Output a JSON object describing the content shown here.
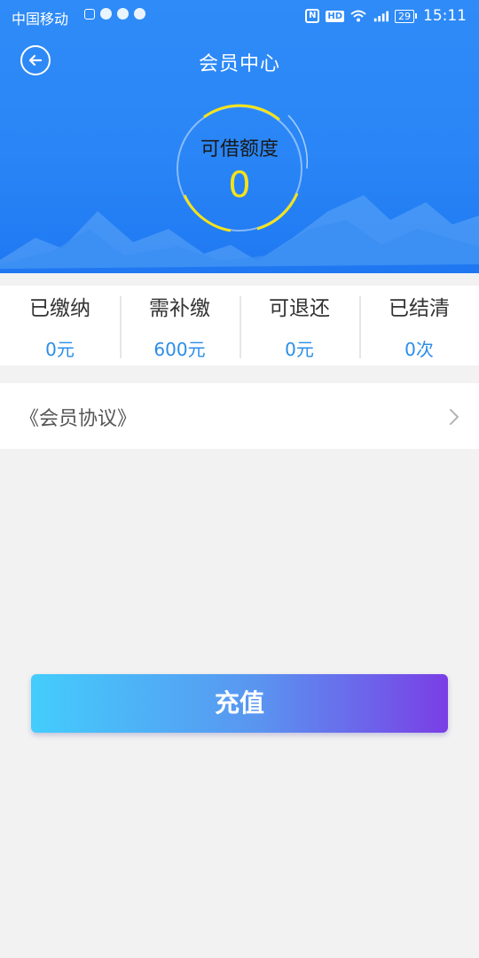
{
  "status_bar": {
    "carrier": "中国移动",
    "battery": "29",
    "time": "15:11"
  },
  "header": {
    "title": "会员中心"
  },
  "credit": {
    "label": "可借额度",
    "value": "0"
  },
  "stats": [
    {
      "label": "已缴纳",
      "value": "0元"
    },
    {
      "label": "需补缴",
      "value": "600元"
    },
    {
      "label": "可退还",
      "value": "0元"
    },
    {
      "label": "已结清",
      "value": "0次"
    }
  ],
  "agreement": {
    "label": "《会员协议》"
  },
  "recharge_button": {
    "label": "充值"
  },
  "colors": {
    "hero_blue": "#2f8bf7",
    "credit_yellow": "#f5e31a",
    "stat_value_blue": "#2a8de8",
    "button_gradient_start": "#43cdfc",
    "button_gradient_end": "#7a3ee6"
  }
}
